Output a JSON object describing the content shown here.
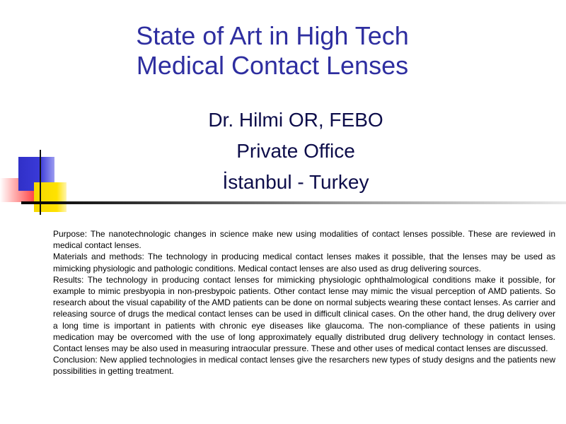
{
  "slide": {
    "title_lines": [
      "State of Art in High Tech",
      "Medical Contact Lenses"
    ],
    "author_lines": [
      "Dr. Hilmi OR, FEBO",
      "Private Office",
      "İstanbul - Turkey"
    ],
    "abstract": {
      "purpose": "Purpose: The nanotechnologic  changes in science make new using modalities of contact lenses possible. These are reviewed in medical contact lenses.",
      "methods": "Materials and methods: The technology  in producing  medical contact lenses makes it possible, that the lenses may be used as mimicking  physiologic and pathologic conditions. Medical contact lenses are also used as drug delivering sources.",
      "results": "Results: The technology  in producing contact lenses for mimicking  physiologic ophthalmological  conditions make it possible, for example to mimic presbyopia in non-presbypoic patients.  Other contact lense may mimic the visual perception of AMD patients. So research about the visual capability of the AMD patients can be done on normal subjects wearing these contact lenses. As carrier and releasing source of drugs the medical contact lenses can be used in difficult clinical cases. On the other hand, the drug delivery over a long time is important in patients with chronic eye diseases like glaucoma. The non-compliance of these patients in using medication may be overcomed with the use of long approximately equally distributed drug delivery technology in contact lenses. Contact lenses may be also used in measuring intraocular pressure. These and other uses of medical contact lenses are discussed.",
      "conclusion": "Conclusion: New applied technologies in medical contact lenses give the resarchers new types of study designs and the patients new possibilities in getting treatment."
    }
  },
  "colors": {
    "title": "#2e2ea0",
    "subtitle": "#0d0d4a",
    "deco_blue": "#3030c8",
    "deco_yellow": "#ffe200",
    "deco_red": "#ff4040"
  }
}
